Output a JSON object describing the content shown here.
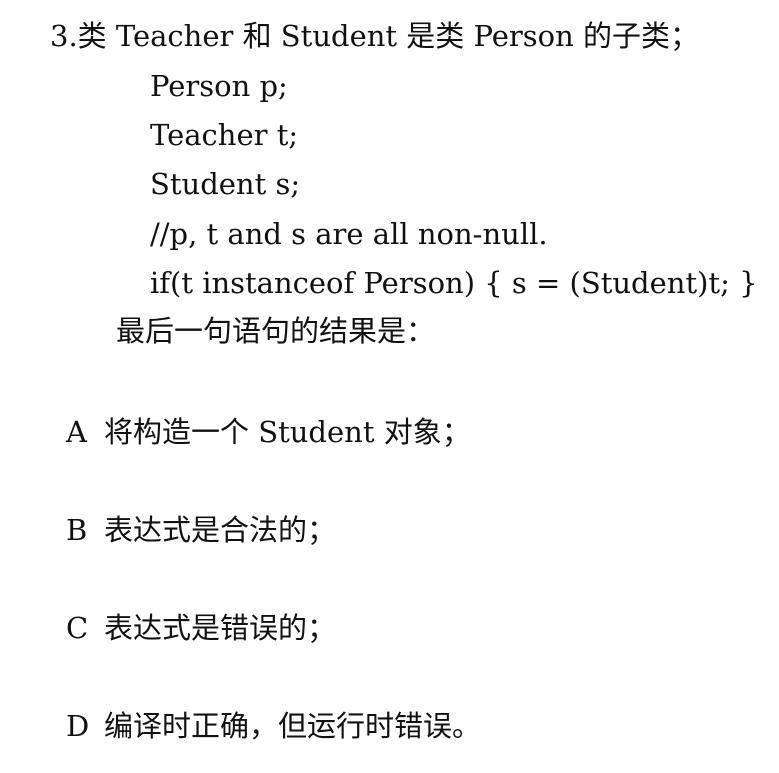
{
  "question": {
    "title": "3.类 Teacher 和 Student 是类 Person 的子类；",
    "code_lines": [
      "Person p;",
      "Teacher t;",
      "Student s;",
      "//p, t and s are all non-null.",
      "if(t instanceof Person) { s = (Student)t; }"
    ],
    "prompt": "最后一句语句的结果是："
  },
  "options": [
    {
      "letter": "A",
      "text": "将构造一个 Student 对象；"
    },
    {
      "letter": "B",
      "text": "表达式是合法的；"
    },
    {
      "letter": "C",
      "text": "表达式是错误的；"
    },
    {
      "letter": "D",
      "text": "编译时正确，但运行时错误。"
    }
  ]
}
